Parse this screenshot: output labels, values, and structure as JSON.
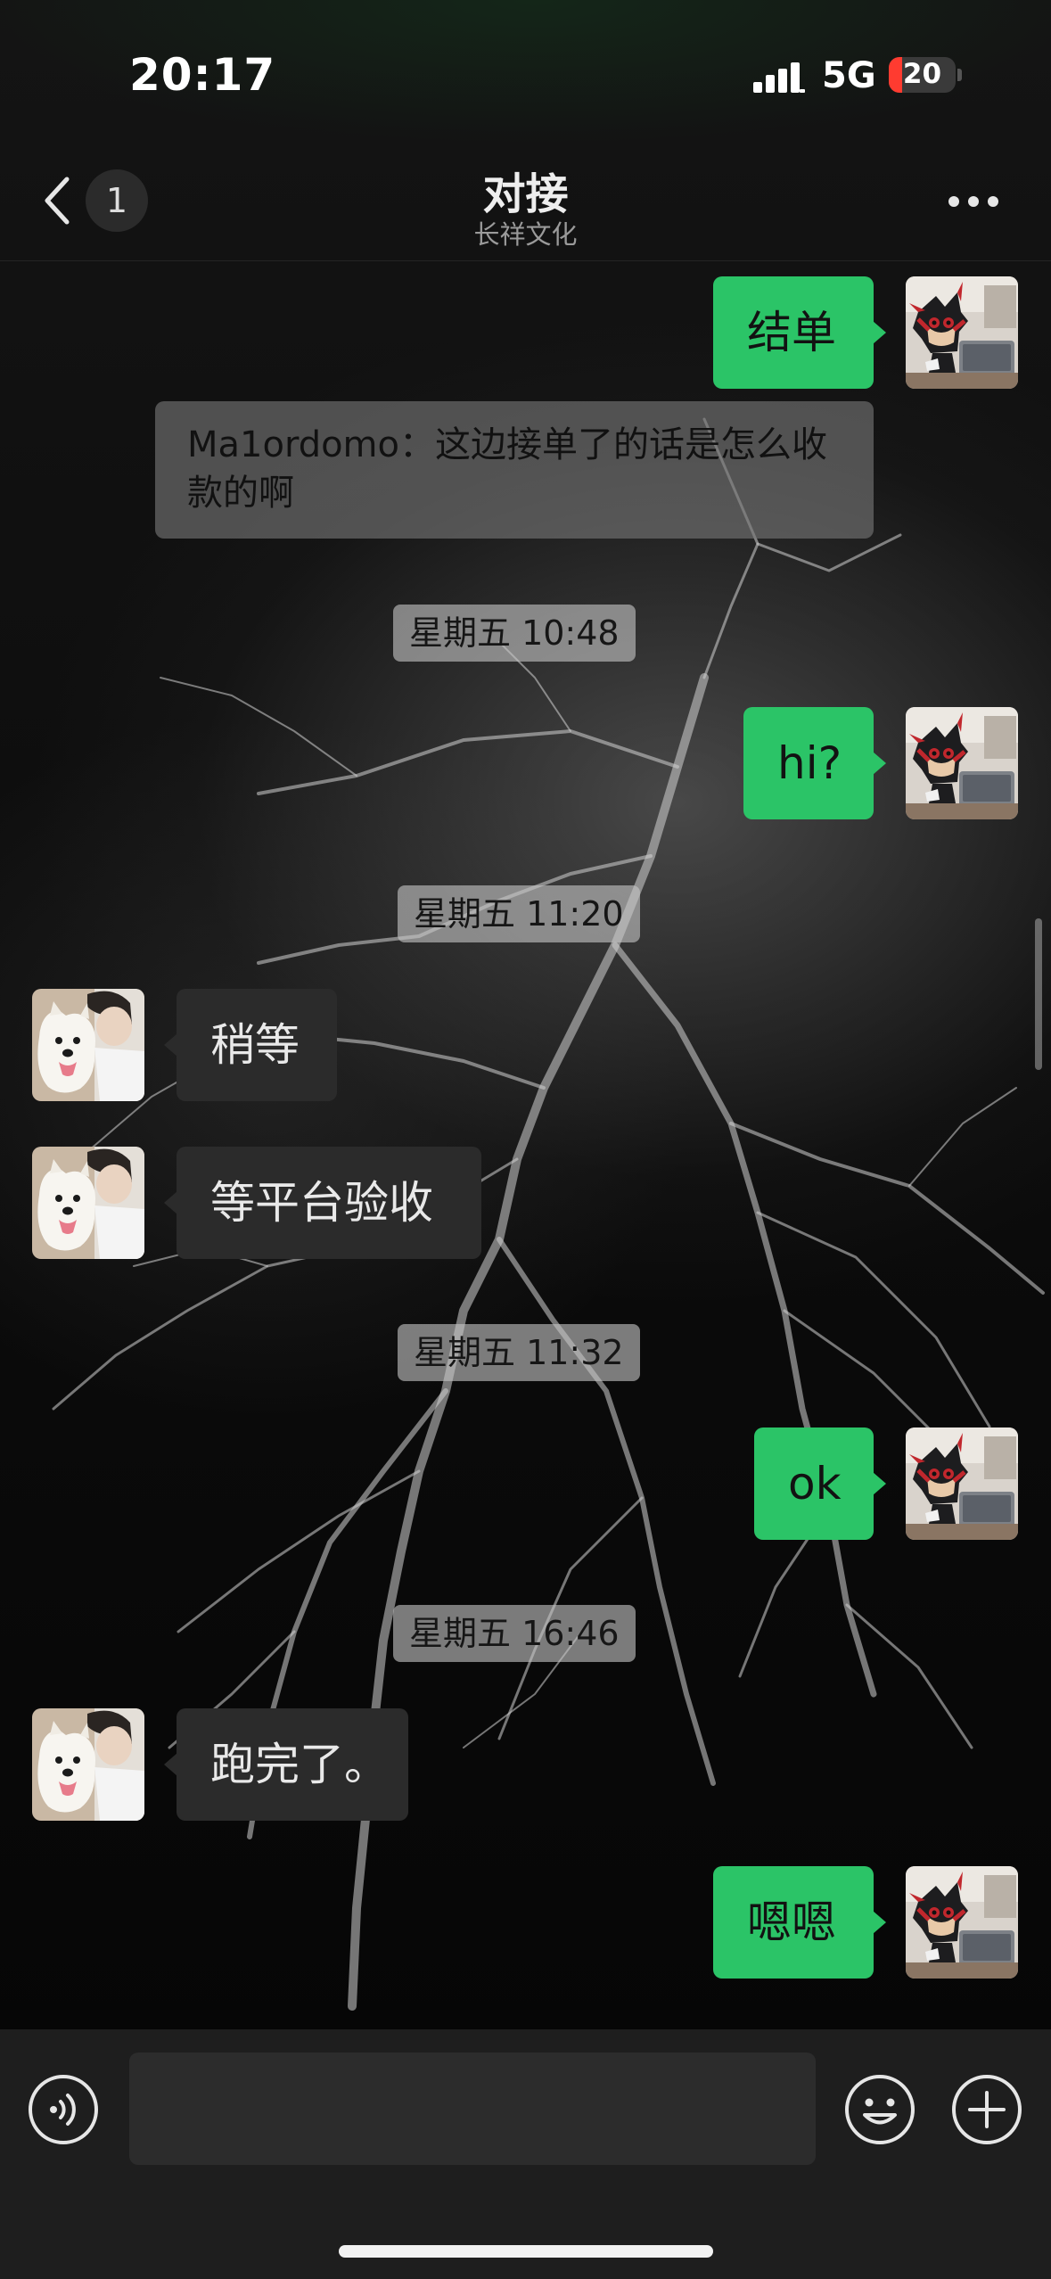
{
  "status_bar": {
    "time": "20:17",
    "network": "5G",
    "battery_level": "20",
    "battery_fraction": 0.2
  },
  "nav": {
    "unread_count": "1",
    "title": "对接",
    "subtitle": "长祥文化"
  },
  "messages": [
    {
      "type": "outgoing",
      "text": "结单"
    },
    {
      "type": "quote",
      "text": "Ma1ordomo：这边接单了的话是怎么收款的啊"
    },
    {
      "type": "time",
      "text": "星期五 10:48"
    },
    {
      "type": "outgoing",
      "text": "hi?"
    },
    {
      "type": "time",
      "text": "星期五 11:20"
    },
    {
      "type": "incoming",
      "text": "稍等"
    },
    {
      "type": "incoming",
      "text": "等平台验收"
    },
    {
      "type": "time",
      "text": "星期五 11:32"
    },
    {
      "type": "outgoing",
      "text": "ok"
    },
    {
      "type": "time",
      "text": "星期五 16:46"
    },
    {
      "type": "incoming",
      "text": "跑完了。"
    },
    {
      "type": "outgoing",
      "text": "嗯嗯"
    }
  ],
  "input": {
    "value": ""
  },
  "icons": {
    "back": "chevron-left-icon",
    "more": "ellipsis-icon",
    "voice": "voice-icon",
    "emoji": "emoji-icon",
    "plus": "plus-icon",
    "self_avatar": "hedgehog-avatar",
    "contact_avatar": "samoyed-avatar"
  },
  "colors": {
    "outgoing_bubble": "#2bc467",
    "incoming_bubble": "#2b2b2b",
    "input_bar": "#1e1e1e",
    "battery_low": "#ff3b30"
  }
}
